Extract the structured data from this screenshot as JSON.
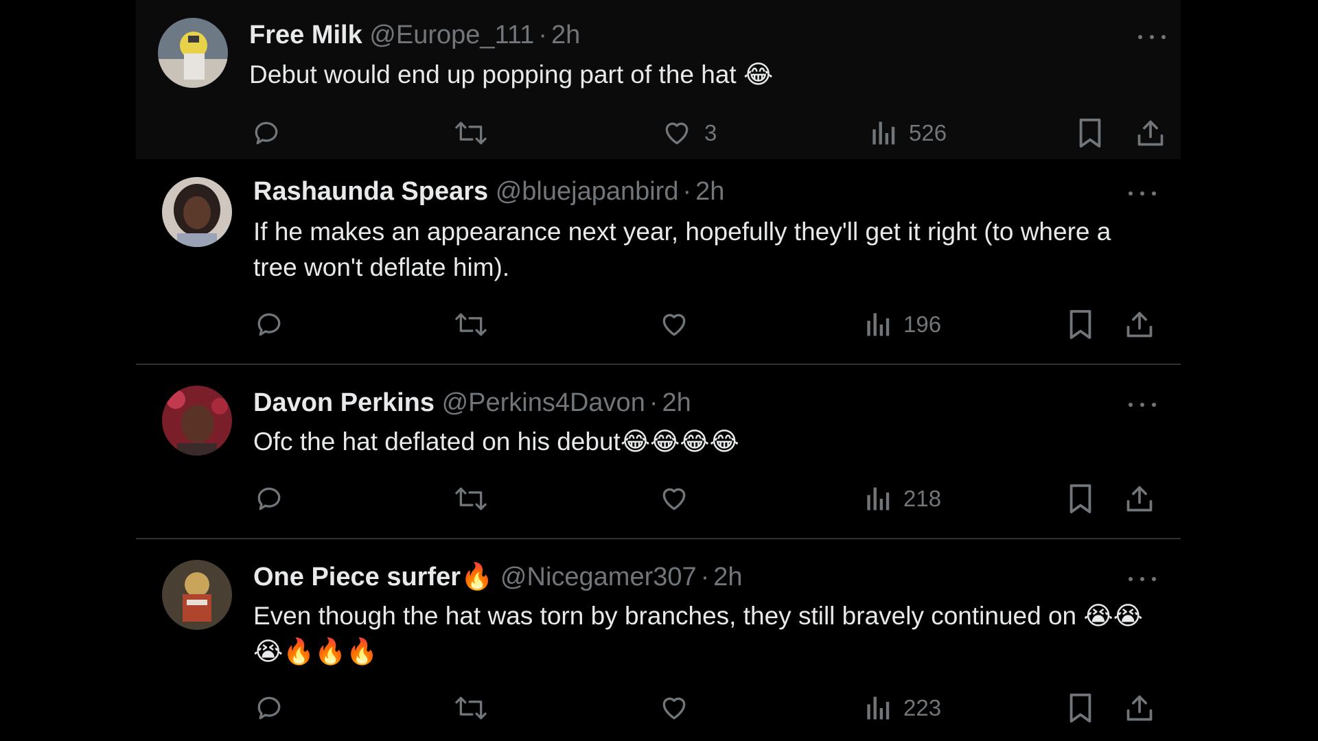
{
  "tweets": [
    {
      "name": "Free Milk",
      "handle": "@Europe_111",
      "separator": "·",
      "time": "2h",
      "text": "Debut would end up popping part of the hat 😂",
      "likes": "3",
      "views": "526"
    },
    {
      "name": "Rashaunda Spears",
      "handle": "@bluejapanbird",
      "separator": "·",
      "time": "2h",
      "text": "If he makes an appearance next year, hopefully they'll get it right (to where a tree won't deflate him).",
      "likes": "",
      "views": "196"
    },
    {
      "name": "Davon Perkins",
      "handle": "@Perkins4Davon",
      "separator": "·",
      "time": "2h",
      "text": "Ofc the hat deflated on his debut😂😂😂😂",
      "likes": "",
      "views": "218"
    },
    {
      "name": "One Piece surfer🔥",
      "handle": "@Nicegamer307",
      "separator": "·",
      "time": "2h",
      "text": "Even though the hat was torn by branches, they still bravely continued on 😭😭😭🔥🔥🔥",
      "likes": "",
      "views": "223"
    }
  ],
  "icons": {
    "reply": "reply-icon",
    "retweet": "retweet-icon",
    "like": "heart-icon",
    "views": "views-icon",
    "bookmark": "bookmark-icon",
    "share": "share-icon",
    "more": "more-icon"
  },
  "colors": {
    "background": "#000000",
    "highlight_background": "#0b0b0b",
    "text": "#e7e9ea",
    "secondary_text": "#71767b",
    "divider": "#2f3336"
  }
}
